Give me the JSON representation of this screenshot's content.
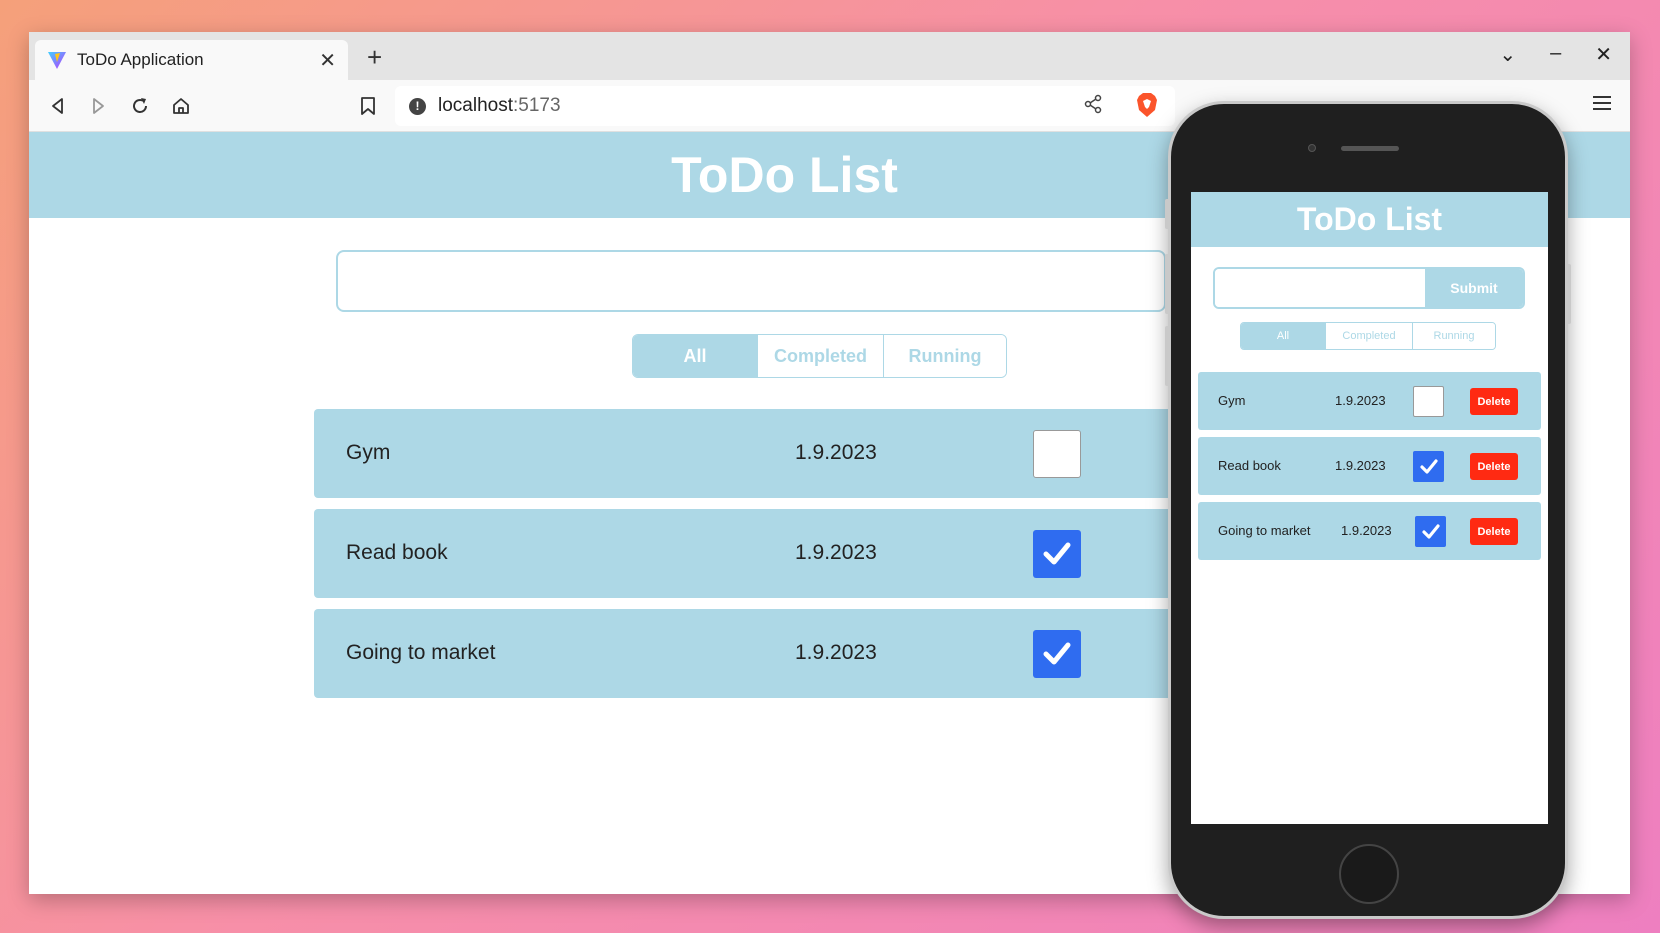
{
  "browser": {
    "tab_title": "ToDo Application",
    "tab_close": "✕",
    "new_tab": "+",
    "url_host": "localhost",
    "url_port": ":5173",
    "win_controls": [
      "⌄",
      "–",
      "✕"
    ]
  },
  "desktop": {
    "title": "ToDo List",
    "input_value": "",
    "filters": [
      {
        "label": "All",
        "active": true
      },
      {
        "label": "Completed",
        "active": false
      },
      {
        "label": "Running",
        "active": false
      }
    ],
    "todos": [
      {
        "name": "Gym",
        "date": "1.9.2023",
        "completed": false
      },
      {
        "name": "Read book",
        "date": "1.9.2023",
        "completed": true
      },
      {
        "name": "Going to market",
        "date": "1.9.2023",
        "completed": true
      }
    ]
  },
  "mobile": {
    "title": "ToDo List",
    "input_value": "",
    "submit_label": "Submit",
    "filters": [
      {
        "label": "All",
        "active": true
      },
      {
        "label": "Completed",
        "active": false
      },
      {
        "label": "Running",
        "active": false
      }
    ],
    "todos": [
      {
        "name": "Gym",
        "date": "1.9.2023",
        "completed": false,
        "delete_label": "Delete"
      },
      {
        "name": "Read book",
        "date": "1.9.2023",
        "completed": true,
        "delete_label": "Delete"
      },
      {
        "name": "Going to market",
        "date": "1.9.2023",
        "completed": true,
        "delete_label": "Delete"
      }
    ]
  },
  "colors": {
    "accent": "#add8e6",
    "checkbox_checked": "#2f6cf0",
    "delete": "#ff2a12"
  }
}
